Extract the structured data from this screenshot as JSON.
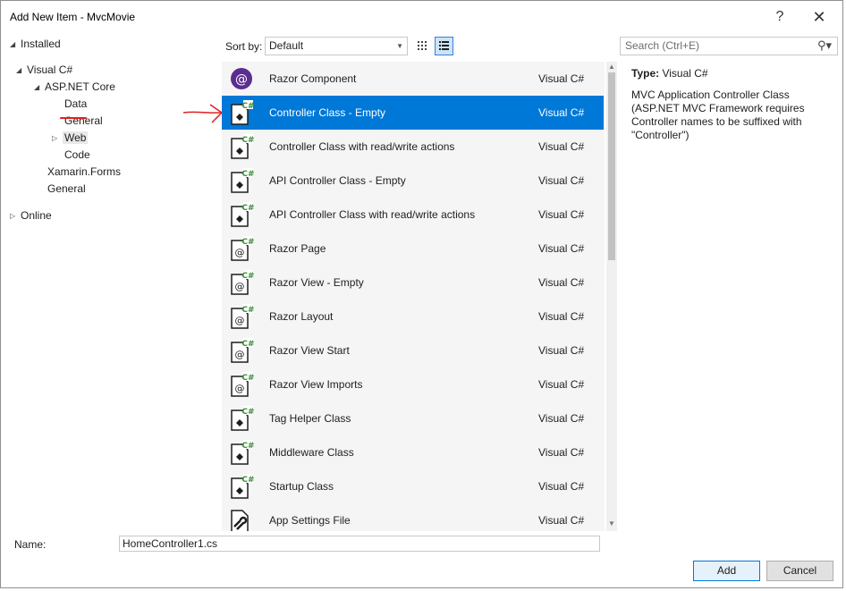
{
  "window": {
    "title": "Add New Item - MvcMovie",
    "help": "?",
    "close": "✕"
  },
  "tree": {
    "installed": "Installed",
    "visual_csharp": "Visual C#",
    "aspnet_core": "ASP.NET Core",
    "data": "Data",
    "general_sub": "General",
    "web": "Web",
    "code": "Code",
    "xamarin": "Xamarin.Forms",
    "general": "General",
    "online": "Online"
  },
  "toolbar": {
    "sort_label": "Sort by:",
    "sort_value": "Default",
    "search_placeholder": "Search (Ctrl+E)"
  },
  "items": [
    {
      "name": "Razor Component",
      "lang": "Visual C#",
      "icon": "razor-component-icon"
    },
    {
      "name": "Controller Class - Empty",
      "lang": "Visual C#",
      "icon": "controller-icon"
    },
    {
      "name": "Controller Class with read/write actions",
      "lang": "Visual C#",
      "icon": "controller-icon"
    },
    {
      "name": "API Controller Class - Empty",
      "lang": "Visual C#",
      "icon": "controller-icon"
    },
    {
      "name": "API Controller Class with read/write actions",
      "lang": "Visual C#",
      "icon": "controller-icon"
    },
    {
      "name": "Razor Page",
      "lang": "Visual C#",
      "icon": "razor-page-icon"
    },
    {
      "name": "Razor View - Empty",
      "lang": "Visual C#",
      "icon": "razor-page-icon"
    },
    {
      "name": "Razor Layout",
      "lang": "Visual C#",
      "icon": "razor-page-icon"
    },
    {
      "name": "Razor View Start",
      "lang": "Visual C#",
      "icon": "razor-page-icon"
    },
    {
      "name": "Razor View Imports",
      "lang": "Visual C#",
      "icon": "razor-page-icon"
    },
    {
      "name": "Tag Helper Class",
      "lang": "Visual C#",
      "icon": "controller-icon"
    },
    {
      "name": "Middleware Class",
      "lang": "Visual C#",
      "icon": "controller-icon"
    },
    {
      "name": "Startup Class",
      "lang": "Visual C#",
      "icon": "controller-icon"
    },
    {
      "name": "App Settings File",
      "lang": "Visual C#",
      "icon": "settings-file-icon"
    }
  ],
  "details": {
    "type_label": "Type:",
    "type_value": "Visual C#",
    "description": "MVC Application Controller Class (ASP.NET MVC Framework requires Controller names to be suffixed with \"Controller\")"
  },
  "bottom": {
    "name_label": "Name:",
    "name_value": "HomeController1.cs",
    "add": "Add",
    "cancel": "Cancel"
  },
  "colors": {
    "selection": "#0078d7",
    "annotation": "#e02020",
    "razor": "#5c2d91",
    "csharp": "#388a34"
  }
}
